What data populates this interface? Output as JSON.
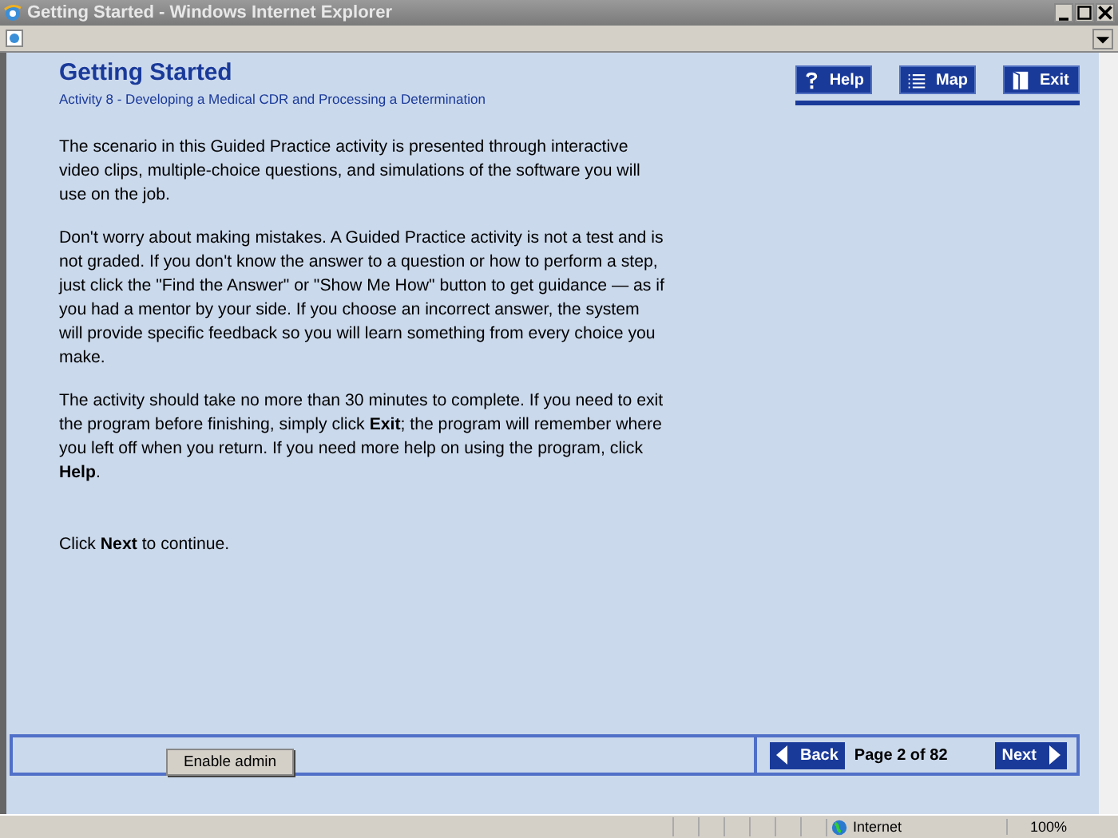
{
  "window": {
    "title": "Getting Started - Windows Internet Explorer"
  },
  "header": {
    "title": "Getting Started",
    "subtitle": "Activity 8 - Developing a Medical CDR and Processing a Determination"
  },
  "nav_buttons": [
    {
      "kind": "help",
      "label": "Help"
    },
    {
      "kind": "map",
      "label": "Map"
    },
    {
      "kind": "exit",
      "label": "Exit"
    }
  ],
  "paragraphs": [
    "The scenario in this Guided Practice activity is presented through interactive video clips, multiple-choice questions, and simulations of the software you will use on the job.",
    "Don't worry about making mistakes. A Guided Practice activity is not a test and is not graded. If you don't know the answer to a question or how to perform a step, just click the \"Find the Answer\" or \"Show Me How\" button to get guidance — as if you had a mentor by your side. If you choose an incorrect answer, the system will provide specific feedback so you will learn something from every choice you make.",
    "The activity should take no more than 30 minutes to complete. If you need to exit the program before finishing, simply click **Exit**; the program will remember where you left off when you return. If you need more help on using the program, click **Help**.",
    "Click **Next** to continue."
  ],
  "admin_button": "Enable admin",
  "pager": {
    "back": "Back",
    "page": "Page 2 of 82",
    "next": "Next"
  },
  "status_bar": {
    "zone": "Internet",
    "zoom": "100%"
  }
}
